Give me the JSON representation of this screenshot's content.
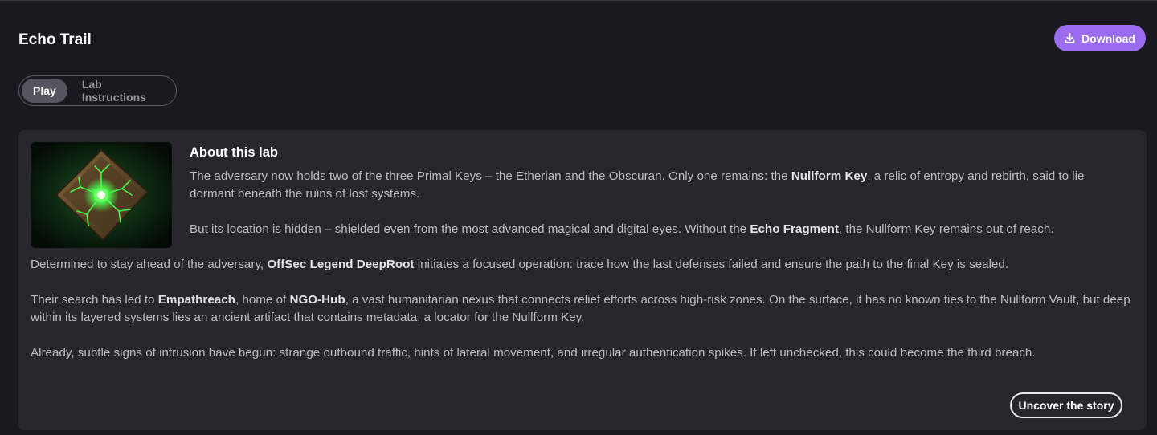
{
  "header": {
    "title": "Echo Trail",
    "download_label": "Download"
  },
  "tabs": [
    {
      "label": "Play",
      "active": true
    },
    {
      "label": "Lab Instructions",
      "active": false
    }
  ],
  "about": {
    "title": "About this lab",
    "p1": {
      "a": "The adversary now holds two of the three Primal Keys – the Etherian and the Obscuran. Only one remains: the ",
      "b": "Nullform Key",
      "c": ", a relic of entropy and rebirth, said to lie dormant beneath the ruins of lost systems."
    },
    "p2": {
      "a": "But its location is hidden – shielded even from the most advanced magical and digital eyes. Without the ",
      "b": "Echo Fragment",
      "c": ", the Nullform Key remains out of reach."
    },
    "p3": {
      "a": "Determined to stay ahead of the adversary, ",
      "b": "OffSec Legend DeepRoot",
      "c": " initiates a focused operation: trace how the last defenses failed and ensure the path to the final Key is sealed."
    },
    "p4": {
      "a": "Their search has led to ",
      "b": "Empathreach",
      "c": ", home of ",
      "d": "NGO-Hub",
      "e": ", a vast humanitarian nexus that connects relief efforts across high-risk zones. On the surface, it has no known ties to the Nullform Vault, but deep within its layered systems lies an ancient artifact that contains metadata, a locator for the Nullform Key."
    },
    "p5": "Already, subtle signs of intrusion have begun: strange outbound traffic, hints of lateral movement, and irregular authentication spikes. If left unchecked, this could become the third breach.",
    "uncover_label": "Uncover the story"
  },
  "icons": {
    "download": "download-icon",
    "thumbnail": "glowing-rune-stone-image"
  },
  "colors": {
    "background": "#1b1920",
    "card": "#28262d",
    "accent": "#9b6bf0",
    "rune_glow": "#39ff4a"
  }
}
